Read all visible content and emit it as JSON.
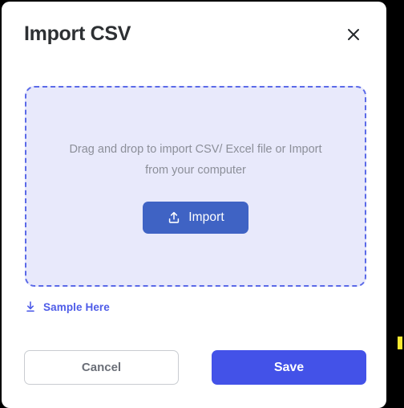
{
  "modal": {
    "title": "Import CSV",
    "close_icon": "close-icon",
    "dropzone": {
      "message": "Drag and drop to import CSV/ Excel file or Import from your computer",
      "import_button": {
        "label": "Import",
        "icon": "upload-icon"
      },
      "border_color": "#5b6ae8",
      "fill_color": "#e8e9fb"
    },
    "sample": {
      "label": "Sample Here",
      "icon": "download-icon",
      "color": "#4e5ce8"
    },
    "footer": {
      "cancel_label": "Cancel",
      "save_label": "Save"
    }
  },
  "colors": {
    "import_blue": "#3f63c4",
    "save_blue": "#4352e8",
    "title_gray": "#2d3033",
    "body_gray": "#8c8f99",
    "marker_yellow": "#fae931"
  }
}
